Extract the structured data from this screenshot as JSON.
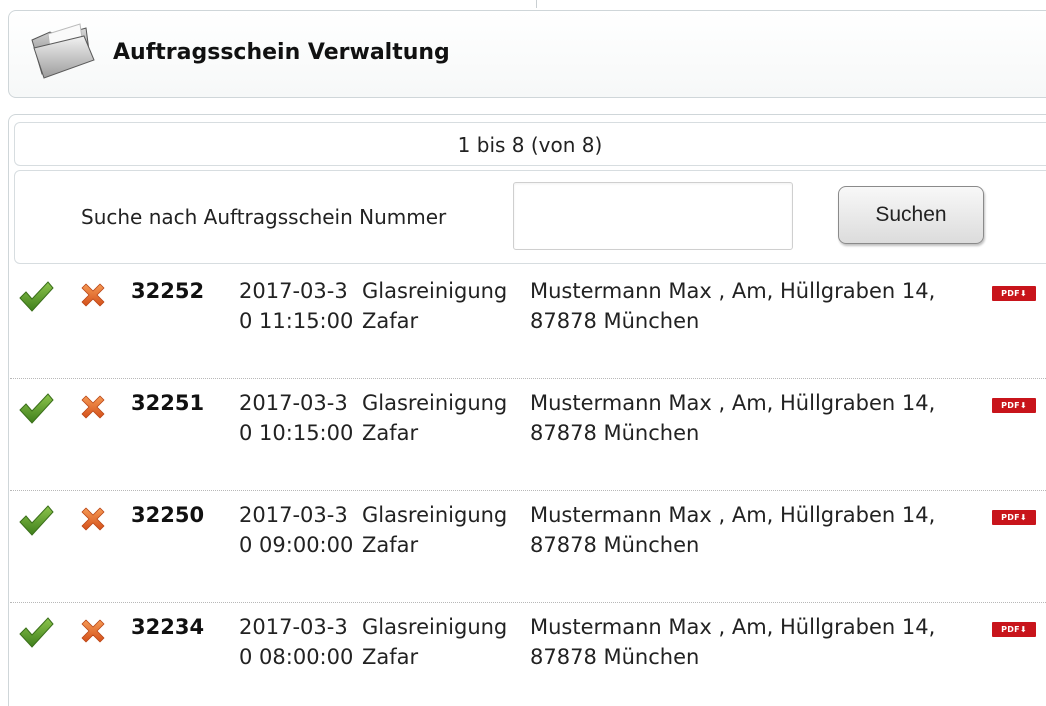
{
  "header": {
    "title": "Auftragsschein Verwaltung",
    "icon": "folder-icon"
  },
  "pager": {
    "text": "1 bis 8 (von 8)"
  },
  "search": {
    "label": "Suche nach Auftragsschein Nummer",
    "value": "",
    "placeholder": "",
    "button_label": "Suchen"
  },
  "colors": {
    "accept_green": "#5a9b2a",
    "reject_orange": "#e2601f",
    "pdf_red": "#c8141b"
  },
  "orders": [
    {
      "number": "32252",
      "datetime": "2017-03-30 11:15:00",
      "company": "Glasreinigung Zafar",
      "address": "Mustermann Max , Am, Hüllgraben 14, 87878 München",
      "pdf_label": "PDF⬇"
    },
    {
      "number": "32251",
      "datetime": "2017-03-30 10:15:00",
      "company": "Glasreinigung Zafar",
      "address": "Mustermann Max , Am, Hüllgraben 14, 87878 München",
      "pdf_label": "PDF⬇"
    },
    {
      "number": "32250",
      "datetime": "2017-03-30 09:00:00",
      "company": "Glasreinigung Zafar",
      "address": "Mustermann Max , Am, Hüllgraben 14, 87878 München",
      "pdf_label": "PDF⬇"
    },
    {
      "number": "32234",
      "datetime": "2017-03-30 08:00:00",
      "company": "Glasreinigung Zafar",
      "address": "Mustermann Max , Am, Hüllgraben 14, 87878 München",
      "pdf_label": "PDF⬇"
    }
  ]
}
